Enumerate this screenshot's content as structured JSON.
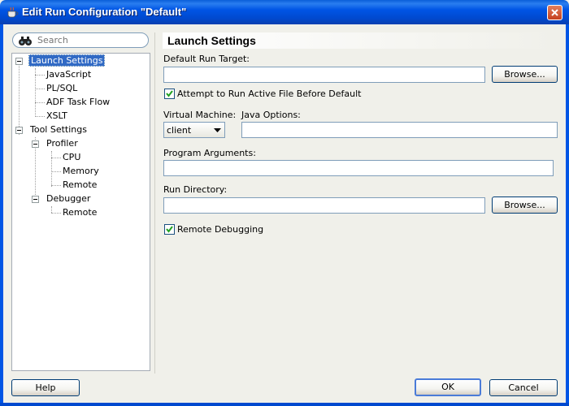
{
  "window": {
    "title": "Edit Run Configuration \"Default\""
  },
  "search": {
    "placeholder": "Search"
  },
  "tree": {
    "items": [
      {
        "label": "Launch Settings"
      },
      {
        "label": "JavaScript"
      },
      {
        "label": "PL/SQL"
      },
      {
        "label": "ADF Task Flow"
      },
      {
        "label": "XSLT"
      },
      {
        "label": "Tool Settings"
      },
      {
        "label": "Profiler"
      },
      {
        "label": "CPU"
      },
      {
        "label": "Memory"
      },
      {
        "label": "Remote"
      },
      {
        "label": "Debugger"
      },
      {
        "label": "Remote"
      }
    ]
  },
  "panel": {
    "title": "Launch Settings",
    "default_run_target": {
      "label": "Default Run Target:",
      "value": ""
    },
    "browse_label": "Browse...",
    "attempt_checkbox": {
      "label": "Attempt to Run Active File Before Default",
      "checked": true
    },
    "virtual_machine": {
      "label": "Virtual Machine:",
      "value": "client"
    },
    "java_options": {
      "label": "Java Options:",
      "value": ""
    },
    "program_arguments": {
      "label": "Program Arguments:",
      "value": ""
    },
    "run_directory": {
      "label": "Run Directory:",
      "value": ""
    },
    "remote_debugging": {
      "label": "Remote Debugging",
      "checked": true
    }
  },
  "footer": {
    "help_label": "Help",
    "ok_label": "OK",
    "cancel_label": "Cancel"
  },
  "colors": {
    "titlebar": "#0055e5",
    "selection": "#316ac5",
    "window_bg": "#f0f0ea"
  }
}
